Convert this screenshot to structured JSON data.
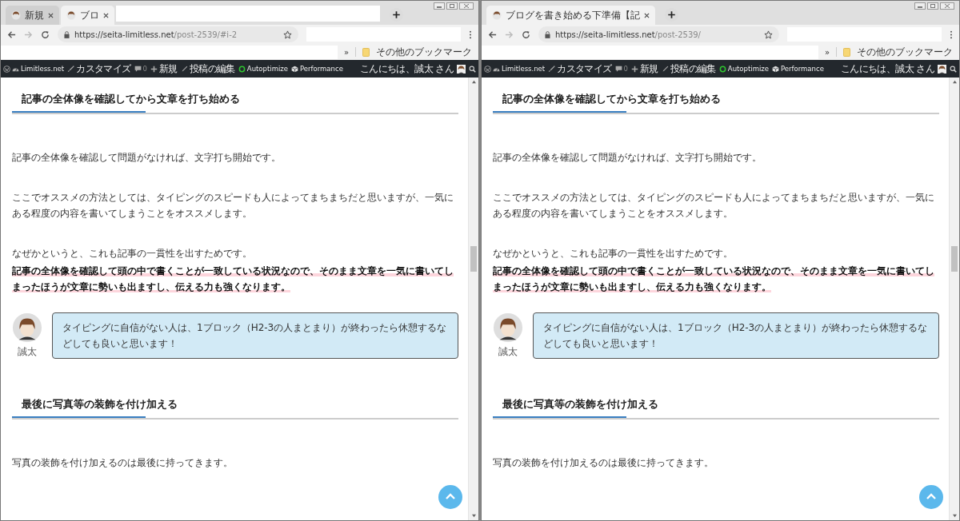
{
  "windows": [
    {
      "tabs": [
        {
          "title": "新規",
          "selected": false
        },
        {
          "title": "ブロ",
          "selected": true
        }
      ],
      "url_host": "https://seita-limitless.net",
      "url_path": "/post-2539/#i-2",
      "bookmarks_more": "その他のブックマーク",
      "chevron": "»",
      "admin_bar": {
        "site": "Limitless.net",
        "customize": "カスタマイズ",
        "comments": "0",
        "new": "新規",
        "edit": "投稿の編集",
        "autoptimize": "Autoptimize",
        "performance": "Performance",
        "greeting": "こんにちは、誠太 さん"
      },
      "content": [
        {
          "kind": "heading",
          "text": "記事の全体像を確認してから文章を打ち始める"
        },
        {
          "kind": "paragraph",
          "text": "記事の全体像を確認して問題がなければ、文字打ち開始です。"
        },
        {
          "kind": "paragraph",
          "text": "ここでオススメの方法としては、タイピングのスピードも人によってまちまちだと思いますが、一気にある程度の内容を書いてしまうことをオススメします。"
        },
        {
          "kind": "paragraph",
          "text": "なぜかというと、これも記事の一貫性を出すためです。"
        },
        {
          "kind": "marker",
          "text": "記事の全体像を確認して頭の中で書くことが一致している状況なので、そのまま文章を一気に書いてしまったほうが文章に勢いも出ますし、伝える力も強くなります。"
        },
        {
          "kind": "speech",
          "name": "誠太",
          "text": "タイピングに自信がない人は、1ブロック（H2-3の人まとまり）が終わったら休憩するなどしても良いと思います！"
        },
        {
          "kind": "heading",
          "text": "最後に写真等の装飾を付け加える"
        },
        {
          "kind": "paragraph",
          "text": "写真の装飾を付け加えるのは最後に持ってきます。"
        }
      ]
    },
    {
      "tabs": [
        {
          "title": "ブログを書き始める下準備【記",
          "selected": true
        }
      ],
      "url_host": "https://seita-limitless.net",
      "url_path": "/post-2539/",
      "bookmarks_more": "その他のブックマーク",
      "chevron": "»",
      "admin_bar": {
        "site": "Limitless.net",
        "customize": "カスタマイズ",
        "comments": "0",
        "new": "新規",
        "edit": "投稿の編集",
        "autoptimize": "Autoptimize",
        "performance": "Performance",
        "greeting": "こんにちは、誠太 さん"
      },
      "content": [
        {
          "kind": "heading",
          "text": "記事の全体像を確認してから文章を打ち始める"
        },
        {
          "kind": "paragraph",
          "text": "記事の全体像を確認して問題がなければ、文字打ち開始です。"
        },
        {
          "kind": "paragraph",
          "text": "ここでオススメの方法としては、タイピングのスピードも人によってまちまちだと思いますが、一気にある程度の内容を書いてしまうことをオススメします。"
        },
        {
          "kind": "paragraph",
          "text": "なぜかというと、これも記事の一貫性を出すためです。"
        },
        {
          "kind": "marker",
          "text": "記事の全体像を確認して頭の中で書くことが一致している状況なので、そのまま文章を一気に書いてしまったほうが文章に勢いも出ますし、伝える力も強くなります。"
        },
        {
          "kind": "speech",
          "name": "誠太",
          "text": "タイピングに自信がない人は、1ブロック（H2-3の人まとまり）が終わったら休憩するなどしても良いと思います！"
        },
        {
          "kind": "heading",
          "text": "最後に写真等の装飾を付け加える"
        },
        {
          "kind": "paragraph",
          "text": "写真の装飾を付け加えるのは最後に持ってきます。"
        }
      ]
    }
  ]
}
